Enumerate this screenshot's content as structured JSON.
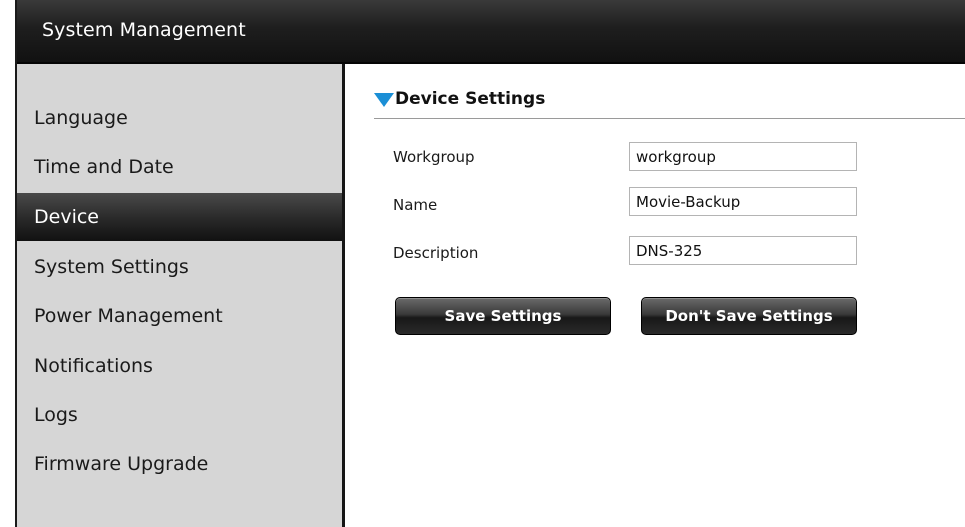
{
  "window": {
    "title": "System Management"
  },
  "sidebar": {
    "items": [
      {
        "label": "Language"
      },
      {
        "label": "Time and Date"
      },
      {
        "label": "Device",
        "active": true
      },
      {
        "label": "System Settings"
      },
      {
        "label": "Power Management"
      },
      {
        "label": "Notifications"
      },
      {
        "label": "Logs"
      },
      {
        "label": "Firmware Upgrade"
      }
    ]
  },
  "device_settings": {
    "title": "Device Settings",
    "fields": [
      {
        "label": "Workgroup",
        "value": "workgroup"
      },
      {
        "label": "Name",
        "value": "Movie-Backup"
      },
      {
        "label": "Description",
        "value": "DNS-325"
      }
    ]
  },
  "buttons": {
    "save": "Save Settings",
    "dont_save": "Don't Save Settings"
  },
  "colors": {
    "accent_triangle": "#1b8fd6",
    "sidebar_bg": "#d6d6d6",
    "header_bg": "#1e1e1e"
  }
}
